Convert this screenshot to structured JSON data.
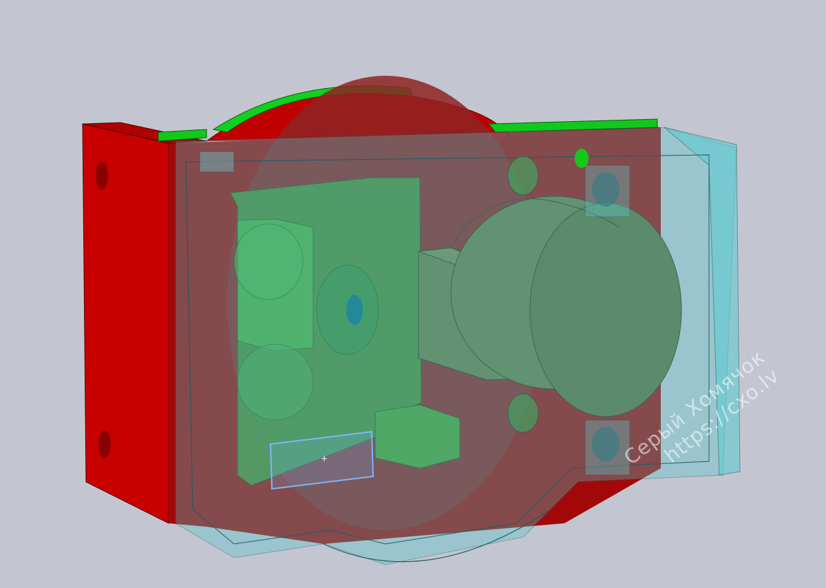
{
  "viewport": {
    "background": "#c3c6d0",
    "view": "3d-isometric",
    "render_style": "shaded-transparent"
  },
  "model": {
    "parts": [
      {
        "name": "rear-panel",
        "color": "#d10000"
      },
      {
        "name": "top-strip",
        "color": "#0fd21a"
      },
      {
        "name": "inner-board",
        "color": "#3aa83a"
      },
      {
        "name": "motor",
        "color": "#6b7a3a"
      },
      {
        "name": "transparent-housing",
        "color": "#53c8cf"
      }
    ],
    "selection": {
      "part": "sketch-rectangle",
      "color": "#7fb6ff"
    }
  },
  "watermark": {
    "line1": "Серый Хомячок",
    "line2": "https://cxo.lv",
    "color": "#ffffff"
  }
}
